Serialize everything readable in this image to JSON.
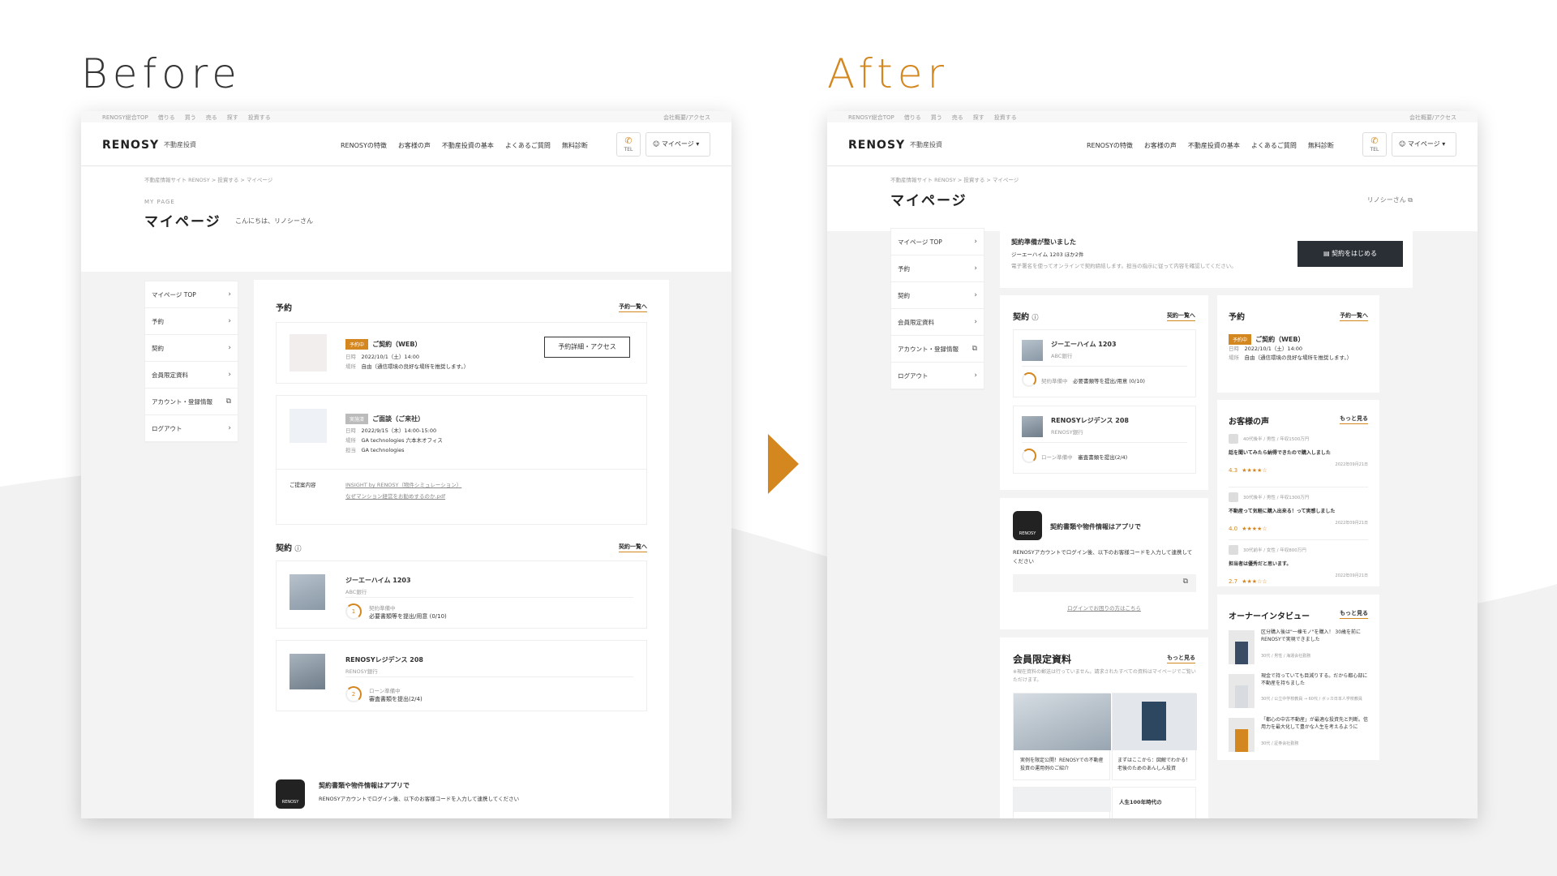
{
  "labels": {
    "before": "Before",
    "after": "After"
  },
  "topbar": {
    "links": [
      "RENOSY総合TOP",
      "借りる",
      "買う",
      "売る",
      "探す",
      "投資する"
    ],
    "right": "会社概要/アクセス"
  },
  "header": {
    "logo": "RENOSY",
    "logo_sub": "不動産投資",
    "nav": [
      "RENOSYの特徴",
      "お客様の声",
      "不動産投資の基本",
      "よくあるご質問",
      "無料診断"
    ],
    "tel": "TEL",
    "mypage": "マイページ"
  },
  "page": {
    "breadcrumb": "不動産情報サイト RENOSY > 投資する > マイページ",
    "eyebrow": "MY PAGE",
    "title": "マイページ",
    "greeting": "こんにちは、リノシーさん",
    "greeting_after": "リノシーさん"
  },
  "sidenav": [
    "マイページ TOP",
    "予約",
    "契約",
    "会員限定資料",
    "アカウント・登録情報",
    "ログアウト"
  ],
  "before": {
    "reserve": {
      "title": "予約",
      "more": "予約一覧へ",
      "item1": {
        "badge": "予約中",
        "name": "ご契約（WEB）",
        "date_label": "日時",
        "date": "2022/10/1（土）14:00",
        "place_label": "場所",
        "place": "自由（通信環境の良好な場所を推奨します。）",
        "button": "予約詳細・アクセス"
      },
      "item2": {
        "badge": "実施済",
        "name": "ご面談（ご来社）",
        "date_label": "日時",
        "date": "2022/9/15（木）14:00-15:00",
        "place_label": "場所",
        "place": "GA technologies 六本木オフィス",
        "staff_label": "担当",
        "staff": "GA technologies"
      },
      "proposal_label": "ご提案内容",
      "proposal_links": [
        "INSIGHT by RENOSY（物件シミュレーション）",
        "なぜマンション経営をお勧めするのか.pdf"
      ]
    },
    "contract": {
      "title": "契約",
      "more": "契約一覧へ",
      "items": [
        {
          "name": "ジーエーハイム 1203",
          "bank": "ABC銀行",
          "status": "契約準備中",
          "detail": "必要書類等を提出/用意 (0/10)",
          "step": "1"
        },
        {
          "name": "RENOSYレジデンス 208",
          "bank": "RENOSY銀行",
          "status": "ローン準備中",
          "detail": "審査書類を提出(2/4)",
          "step": "2"
        }
      ]
    },
    "app": {
      "title": "契約書類や物件情報はアプリで",
      "desc": "RENOSYアカウントでログイン後、以下のお客様コードを入力して連携してください",
      "icon_text": "RENOSY"
    }
  },
  "after": {
    "notice": {
      "title": "契約準備が整いました",
      "sub": "ジーエーハイム 1203 ほか2件",
      "desc": "電子署名を使ってオンラインで契約締結します。担当の指示に従って内容を確認してください。",
      "button": "契約をはじめる"
    },
    "contract": {
      "title": "契約",
      "more": "契約一覧へ",
      "items": [
        {
          "name": "ジーエーハイム 1203",
          "bank": "ABC銀行",
          "status": "契約準備中",
          "detail": "必要書類等を提出/用意 (0/10)",
          "step": "1"
        },
        {
          "name": "RENOSYレジデンス 208",
          "bank": "RENOSY銀行",
          "status": "ローン準備中",
          "detail": "審査書類を提出(2/4)",
          "step": "2"
        }
      ]
    },
    "reserve": {
      "title": "予約",
      "more": "予約一覧へ",
      "badge": "予約中",
      "name": "ご契約（WEB）",
      "date_label": "日時",
      "date": "2022/10/1（土）14:00",
      "place_label": "場所",
      "place": "自由（通信環境の良好な場所を推奨します。）"
    },
    "app": {
      "title": "契約書類や物件情報はアプリで",
      "desc": "RENOSYアカウントでログイン後、以下のお客様コードを入力して連携してください",
      "help": "ログインでお困りの方はこちら",
      "icon_text": "RENOSY"
    },
    "voices": {
      "title": "お客様の声",
      "more": "もっと見る",
      "items": [
        {
          "meta": "40代後半 / 男性 / 年収1500万円",
          "text": "話を聞いてみたら納得できたので購入しました",
          "score": "4.3",
          "stars": "★★★★☆",
          "date": "2022年09月21日"
        },
        {
          "meta": "30代後半 / 男性 / 年収1300万円",
          "text": "不動産って気軽に購入出来る！って実感しました",
          "score": "4.0",
          "stars": "★★★★☆",
          "date": "2022年09月21日"
        },
        {
          "meta": "30代前半 / 女性 / 年収800万円",
          "text": "担当者は優秀だと思います。",
          "score": "2.7",
          "stars": "★★★☆☆",
          "date": "2022年09月21日"
        }
      ]
    },
    "interviews": {
      "title": "オーナーインタビュー",
      "more": "もっと見る",
      "items": [
        {
          "text": "区分購入後は\"一棟モノ\"を購入！ 30歳を前にRENOSYで実現できました",
          "meta": "30代 / 男性 / 海運会社勤務"
        },
        {
          "text": "現金で持っていても目減りする。だから都心部に不動産を持ちました",
          "meta": "30代 / 公立中学校教員 → 60代 / ボッカ日本人学校教員"
        },
        {
          "text": "「都心の中古不動産」が最適な投資先と判断。信用力を最大化して豊かな人生を考えるように",
          "meta": "30代 / 証券会社勤務"
        }
      ]
    },
    "materials": {
      "title": "会員限定資料",
      "more": "もっと見る",
      "note": "※現在資料の郵送は行っていません。請求されたすべての資料はマイページでご覧いただけます。",
      "items": [
        "実例を限定公開！RENOSYでの不動産投資の運用例のご紹介",
        "まずはここから：図解でわかる！老後のためのあんしん投資",
        "",
        "人生100年時代の"
      ]
    }
  }
}
